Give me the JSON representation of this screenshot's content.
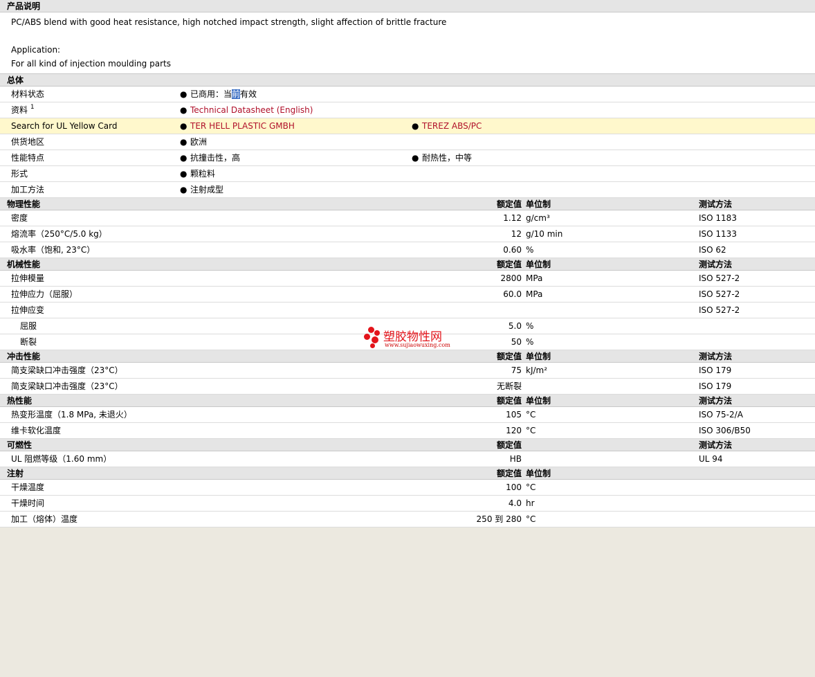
{
  "description": {
    "title": "产品说明",
    "line1": "PC/ABS blend with good heat resistance, high notched impact strength, slight affection of brittle fracture",
    "application_label": "Application:",
    "application_text": "For all kind of injection moulding parts"
  },
  "general": {
    "title": "总体",
    "rows": [
      {
        "label": "材料状态",
        "value_pre": "已商用：当",
        "value_sel": "前",
        "value_post": "有效"
      },
      {
        "label": "资料",
        "sup": "1",
        "link1": "Technical Datasheet (English)"
      },
      {
        "label": "Search for UL Yellow Card",
        "link1": "TER HELL PLASTIC GMBH",
        "link2": "TEREZ ABS/PC"
      },
      {
        "label": "供货地区",
        "text1": "欧洲"
      },
      {
        "label": "性能特点",
        "text1": "抗撞击性，高",
        "text2": "耐热性，中等"
      },
      {
        "label": "形式",
        "text1": "颗粒料"
      },
      {
        "label": "加工方法",
        "text1": "注射成型"
      }
    ]
  },
  "headers": {
    "value": "额定值",
    "unit": "单位制",
    "test": "测试方法"
  },
  "physical": {
    "title": "物理性能",
    "rows": [
      {
        "label": "密度",
        "value": "1.12",
        "unit": "g/cm³",
        "test": "ISO 1183"
      },
      {
        "label": "熔流率（250°C/5.0 kg）",
        "value": "12",
        "unit": "g/10 min",
        "test": "ISO 1133"
      },
      {
        "label": "吸水率（饱和, 23°C）",
        "value": "0.60",
        "unit": "%",
        "test": "ISO 62"
      }
    ]
  },
  "mechanical": {
    "title": "机械性能",
    "rows": [
      {
        "label": "拉伸模量",
        "value": "2800",
        "unit": "MPa",
        "test": "ISO 527-2"
      },
      {
        "label": "拉伸应力（屈服）",
        "value": "60.0",
        "unit": "MPa",
        "test": "ISO 527-2"
      },
      {
        "label": "拉伸应变",
        "value": "",
        "unit": "",
        "test": "ISO 527-2"
      },
      {
        "label": "屈服",
        "value": "5.0",
        "unit": "%",
        "test": ""
      },
      {
        "label": "断裂",
        "value": "50",
        "unit": "%",
        "test": ""
      }
    ]
  },
  "impact": {
    "title": "冲击性能",
    "rows": [
      {
        "label": "简支梁缺口冲击强度（23°C）",
        "value": "75",
        "unit": "kJ/m²",
        "test": "ISO 179"
      },
      {
        "label": "简支梁缺口冲击强度（23°C）",
        "value": "无断裂",
        "unit": "",
        "test": "ISO 179"
      }
    ]
  },
  "thermal": {
    "title": "热性能",
    "rows": [
      {
        "label": "热变形温度（1.8 MPa, 未退火）",
        "value": "105",
        "unit": "°C",
        "test": "ISO 75-2/A"
      },
      {
        "label": "维卡软化温度",
        "value": "120",
        "unit": "°C",
        "test": "ISO 306/B50"
      }
    ]
  },
  "flammability": {
    "title": "可燃性",
    "rows": [
      {
        "label": "UL 阻燃等级（1.60 mm）",
        "value": "HB",
        "unit": "",
        "test": "UL 94"
      }
    ]
  },
  "injection": {
    "title": "注射",
    "rows": [
      {
        "label": "干燥温度",
        "value": "100",
        "unit": "°C",
        "test": ""
      },
      {
        "label": "干燥时间",
        "value": "4.0",
        "unit": "hr",
        "test": ""
      },
      {
        "label": "加工（熔体）温度",
        "value": "250 到  280",
        "unit": "°C",
        "test": ""
      }
    ]
  },
  "watermark": {
    "cn": "塑胶物性网",
    "en": "www.sujiaowuxing.com",
    "color": "#e3141b"
  },
  "colors": {
    "link": "#b0102a",
    "highlight_row": "#fff8cc",
    "section_bg": "#e5e5e5",
    "page_bg": "#ece9e0"
  }
}
